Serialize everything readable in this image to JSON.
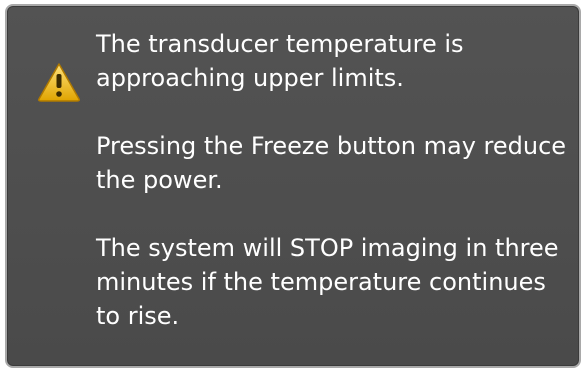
{
  "alert": {
    "icon": "warning-icon",
    "messages": [
      "The transducer temperature is approaching upper limits.",
      "Pressing the Freeze button may reduce the power.",
      "The system will STOP imaging in three minutes if the temperature continues to rise."
    ]
  },
  "colors": {
    "dialog_bg": "#4f4f4f",
    "border": "#a9a9a9",
    "text": "#ffffff",
    "warning_yellow": "#f3c41c"
  }
}
